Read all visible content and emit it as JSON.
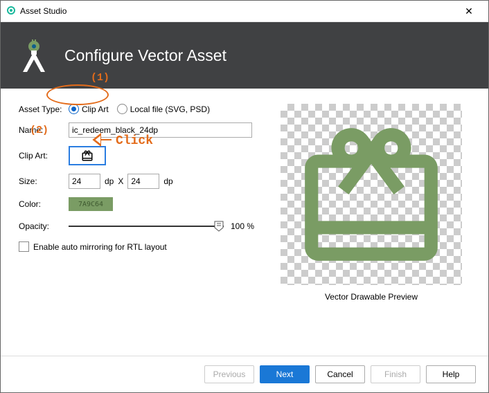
{
  "window": {
    "title": "Asset Studio",
    "close": "✕"
  },
  "header": {
    "title": "Configure Vector Asset"
  },
  "labels": {
    "assetType": "Asset Type:",
    "name": "Name:",
    "clipArt": "Clip Art:",
    "size": "Size:",
    "color": "Color:",
    "opacity": "Opacity:",
    "dp": "dp",
    "x": "X",
    "previewTitle": "Vector Drawable Preview"
  },
  "assetType": {
    "clipArt": "Clip Art",
    "localFile": "Local file (SVG, PSD)",
    "selected": "clipArt"
  },
  "name": "ic_redeem_black_24dp",
  "size": {
    "w": "24",
    "h": "24"
  },
  "color": "7A9C64",
  "opacity": {
    "value": "100",
    "pctLabel": "100 %"
  },
  "rtl": {
    "checked": false,
    "label": "Enable auto mirroring for RTL layout"
  },
  "buttons": {
    "previous": "Previous",
    "next": "Next",
    "cancel": "Cancel",
    "finish": "Finish",
    "help": "Help"
  },
  "annotations": {
    "one": "(1)",
    "two": "(2)",
    "click": "Click"
  }
}
